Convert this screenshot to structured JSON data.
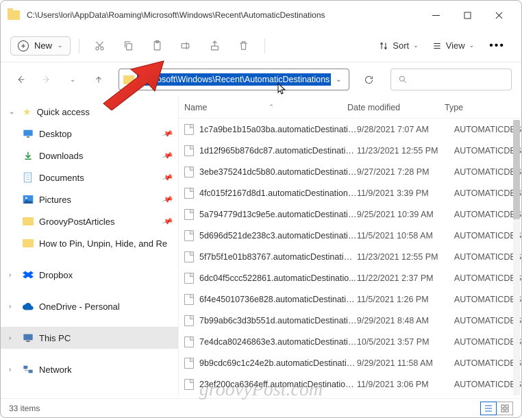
{
  "window": {
    "title": "C:\\Users\\lori\\AppData\\Roaming\\Microsoft\\Windows\\Recent\\AutomaticDestinations"
  },
  "toolbar": {
    "new_label": "New",
    "sort_label": "Sort",
    "view_label": "View"
  },
  "address": {
    "path": "\\Microsoft\\Windows\\Recent\\AutomaticDestinations"
  },
  "columns": {
    "name": "Name",
    "date": "Date modified",
    "type": "Type"
  },
  "sidebar": {
    "quick_access": "Quick access",
    "items": [
      {
        "label": "Desktop",
        "icon": "desktop",
        "pinned": true
      },
      {
        "label": "Downloads",
        "icon": "downloads",
        "pinned": true
      },
      {
        "label": "Documents",
        "icon": "documents",
        "pinned": true
      },
      {
        "label": "Pictures",
        "icon": "pictures",
        "pinned": true
      },
      {
        "label": "GroovyPostArticles",
        "icon": "folder",
        "pinned": true
      },
      {
        "label": "How to Pin, Unpin, Hide, and Re",
        "icon": "folder",
        "pinned": false
      }
    ],
    "dropbox": "Dropbox",
    "onedrive": "OneDrive - Personal",
    "thispc": "This PC",
    "network": "Network"
  },
  "files": [
    {
      "name": "1c7a9be1b15a03ba.automaticDestinatio...",
      "date": "9/28/2021 7:07 AM",
      "type": "AUTOMATICDES"
    },
    {
      "name": "1d12f965b876dc87.automaticDestinatio...",
      "date": "11/23/2021 12:55 PM",
      "type": "AUTOMATICDES"
    },
    {
      "name": "3ebe375241dc5b80.automaticDestinatio...",
      "date": "9/27/2021 7:28 PM",
      "type": "AUTOMATICDES"
    },
    {
      "name": "4fc015f2167d8d1.automaticDestinations-...",
      "date": "11/9/2021 3:39 PM",
      "type": "AUTOMATICDES"
    },
    {
      "name": "5a794779d13c9e5e.automaticDestinatio...",
      "date": "9/25/2021 10:39 AM",
      "type": "AUTOMATICDES"
    },
    {
      "name": "5d696d521de238c3.automaticDestinatio...",
      "date": "11/5/2021 10:58 AM",
      "type": "AUTOMATICDES"
    },
    {
      "name": "5f7b5f1e01b83767.automaticDestination...",
      "date": "11/23/2021 12:55 PM",
      "type": "AUTOMATICDES"
    },
    {
      "name": "6dc04f5ccc522861.automaticDestinatio...",
      "date": "11/22/2021 2:37 PM",
      "type": "AUTOMATICDES"
    },
    {
      "name": "6f4e45010736e828.automaticDestinatio...",
      "date": "11/5/2021 1:26 PM",
      "type": "AUTOMATICDES"
    },
    {
      "name": "7b99ab6c3d3b551d.automaticDestinatio...",
      "date": "9/29/2021 8:48 AM",
      "type": "AUTOMATICDES"
    },
    {
      "name": "7e4dca80246863e3.automaticDestinatio...",
      "date": "10/5/2021 3:57 PM",
      "type": "AUTOMATICDES"
    },
    {
      "name": "9b9cdc69c1c24e2b.automaticDestinatio...",
      "date": "9/29/2021 11:58 AM",
      "type": "AUTOMATICDES"
    },
    {
      "name": "23ef200ca6364eff.automaticDestinations-...",
      "date": "11/9/2021 3:06 PM",
      "type": "AUTOMATICDES"
    }
  ],
  "status": {
    "count": "33 items"
  },
  "watermark": "groovyPost.com"
}
